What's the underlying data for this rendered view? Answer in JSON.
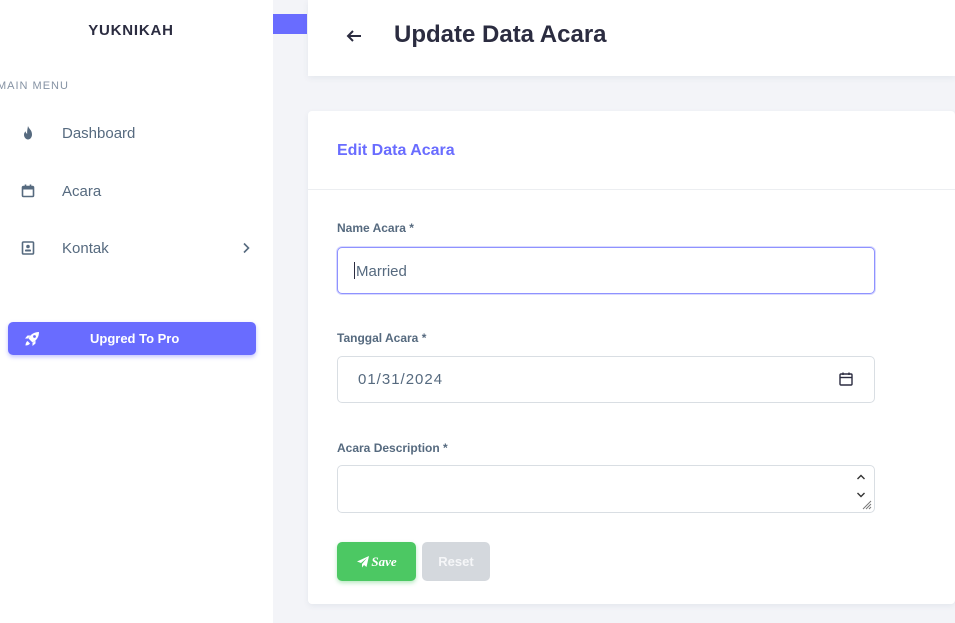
{
  "sidebar": {
    "brand": "YUKNIKAH",
    "menu_header": "MAIN MENU",
    "items": [
      {
        "label": "Dashboard",
        "icon": "fire-icon"
      },
      {
        "label": "Acara",
        "icon": "calendar-icon"
      },
      {
        "label": "Kontak",
        "icon": "contact-icon",
        "has_submenu": true
      }
    ],
    "upgrade_label": "Upgred To Pro",
    "upgrade_icon": "rocket-icon"
  },
  "header": {
    "back_icon": "arrow-left-icon",
    "title": "Update Data Acara"
  },
  "form": {
    "card_title": "Edit Data Acara",
    "name_label": "Name Acara *",
    "name_value": "Married",
    "date_label": "Tanggal Acara *",
    "date_value": "01/31/2024",
    "description_label": "Acara Description *",
    "description_value": "",
    "save_label": "Save",
    "reset_label": "Reset"
  },
  "colors": {
    "primary": "#696cff",
    "success": "#4cc863",
    "secondary": "#d4d8dd",
    "background": "#f3f4f8"
  }
}
